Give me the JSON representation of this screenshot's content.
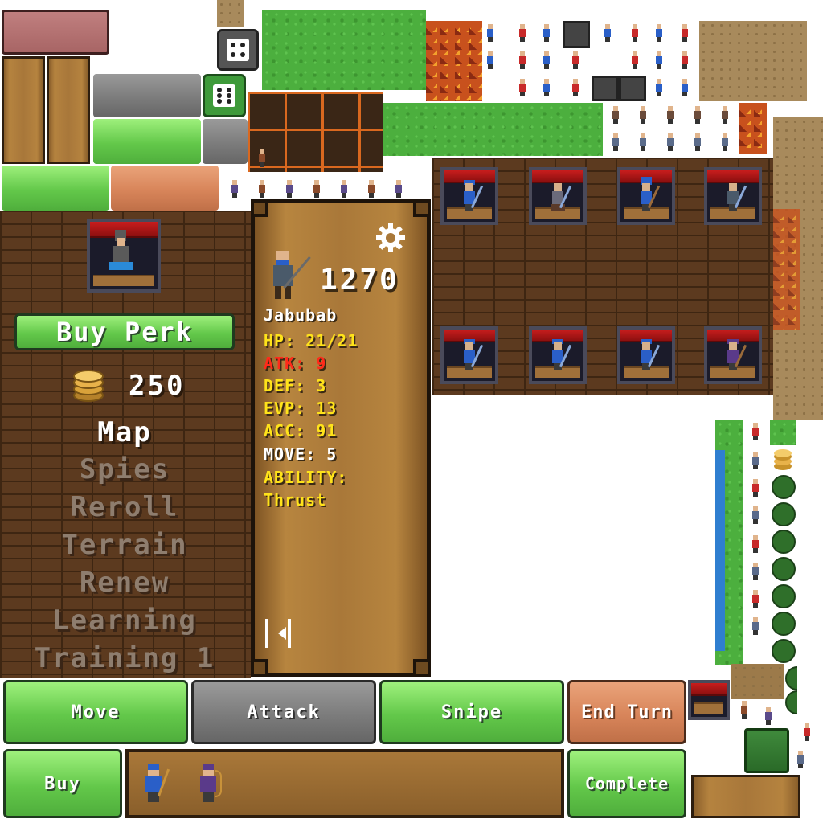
{
  "left_panel": {
    "buy_perk_label": "Buy Perk",
    "gold_amount": "250",
    "menu_items": [
      {
        "label": "Map",
        "active": true
      },
      {
        "label": "Spies",
        "active": false
      },
      {
        "label": "Reroll",
        "active": false
      },
      {
        "label": "Terrain",
        "active": false
      },
      {
        "label": "Renew",
        "active": false
      },
      {
        "label": "Learning",
        "active": false
      },
      {
        "label": "Training 1",
        "active": false
      }
    ]
  },
  "unit_card": {
    "score": "1270",
    "name": "Jabubab",
    "hp": "HP: 21/21",
    "atk": "ATK: 9",
    "def": "DEF: 3",
    "evp": "EVP: 13",
    "acc": "ACC: 91",
    "move": "MOVE: 5",
    "ability_label": "ABILITY:",
    "ability_value": "Thrust"
  },
  "actions": {
    "move": "Move",
    "attack": "Attack",
    "snipe": "Snipe",
    "end_turn": "End Turn",
    "buy": "Buy",
    "complete": "Complete"
  },
  "colors": {
    "stat_yellow": "#ffe31a",
    "stat_red": "#ff2a1a",
    "stat_white": "#ffffff"
  },
  "icons": [
    "dice-icon",
    "gear-icon",
    "collapse-icon",
    "gold-coins-icon"
  ]
}
